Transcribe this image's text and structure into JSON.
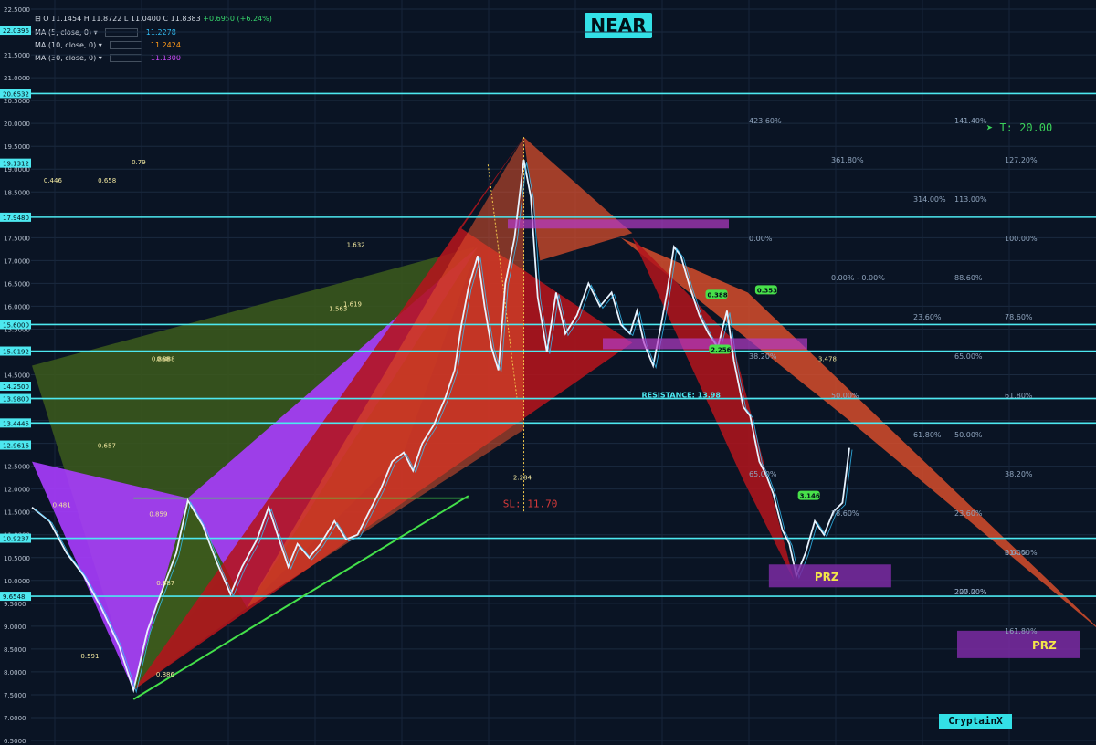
{
  "header": {
    "title": "NEAR",
    "ohlc": "O 11.1454  H 11.8722  L 11.0400  C 11.8383",
    "change": "+0.6950 (+6.24%)",
    "ma": [
      {
        "label": "MA (5, close, 0) ▾",
        "value": "11.2278",
        "color": "#33c6ff"
      },
      {
        "label": "MA (10, close, 0) ▾",
        "value": "11.2424",
        "color": "#ff9a1a"
      },
      {
        "label": "MA (30, close, 0) ▾",
        "value": "11.1300",
        "color": "#d24cff"
      }
    ]
  },
  "watermark": "CryptainX",
  "chart_data": {
    "type": "line",
    "ylim": [
      6.6,
      22.5
    ],
    "y_ticks": [
      "22.5000",
      "22.0000",
      "21.5000",
      "21.0000",
      "20.5000",
      "20.0000",
      "19.5000",
      "19.0000",
      "18.5000",
      "18.0000",
      "17.5000",
      "17.0000",
      "16.5000",
      "16.0000",
      "15.5000",
      "15.0000",
      "14.5000",
      "14.0000",
      "13.5000",
      "13.0000",
      "12.5000",
      "12.0000",
      "11.5000",
      "11.0000",
      "10.5000",
      "10.0000",
      "9.5000",
      "9.0000",
      "8.5000",
      "8.0000",
      "7.5000",
      "7.0000",
      "6.5000"
    ],
    "highlighted_y_labels": [
      {
        "value": 22.0396,
        "text": "22.0396"
      },
      {
        "value": 20.6532,
        "text": "20.6532"
      },
      {
        "value": 19.1312,
        "text": "19.1312"
      },
      {
        "value": 17.948,
        "text": "17.9480"
      },
      {
        "value": 15.6,
        "text": "15.6000"
      },
      {
        "value": 15.0192,
        "text": "15.0192"
      },
      {
        "value": 14.25,
        "text": "14.2500"
      },
      {
        "value": 13.98,
        "text": "13.9800"
      },
      {
        "value": 13.4445,
        "text": "13.4445"
      },
      {
        "value": 12.9616,
        "text": "12.9616"
      },
      {
        "value": 10.9237,
        "text": "10.9237"
      },
      {
        "value": 9.6548,
        "text": "9.6548"
      }
    ],
    "horizontal_levels": [
      20.6532,
      17.948,
      15.6,
      15.0192,
      13.98,
      13.4445,
      10.9237,
      9.6548
    ],
    "price": [
      [
        0,
        11.6
      ],
      [
        15,
        11.3
      ],
      [
        30,
        10.6
      ],
      [
        45,
        10.1
      ],
      [
        60,
        9.4
      ],
      [
        75,
        8.6
      ],
      [
        88,
        7.6
      ],
      [
        100,
        8.9
      ],
      [
        110,
        9.6
      ],
      [
        125,
        10.6
      ],
      [
        135,
        11.75
      ],
      [
        148,
        11.2
      ],
      [
        160,
        10.4
      ],
      [
        172,
        9.7
      ],
      [
        182,
        10.3
      ],
      [
        195,
        10.9
      ],
      [
        205,
        11.6
      ],
      [
        214,
        10.9
      ],
      [
        222,
        10.3
      ],
      [
        230,
        10.8
      ],
      [
        240,
        10.5
      ],
      [
        250,
        10.8
      ],
      [
        262,
        11.3
      ],
      [
        272,
        10.9
      ],
      [
        282,
        11.0
      ],
      [
        292,
        11.5
      ],
      [
        302,
        12.0
      ],
      [
        312,
        12.6
      ],
      [
        322,
        12.8
      ],
      [
        330,
        12.4
      ],
      [
        338,
        13.0
      ],
      [
        348,
        13.4
      ],
      [
        358,
        14.0
      ],
      [
        366,
        14.6
      ],
      [
        372,
        15.6
      ],
      [
        378,
        16.4
      ],
      [
        386,
        17.1
      ],
      [
        392,
        16.0
      ],
      [
        398,
        15.1
      ],
      [
        404,
        14.6
      ],
      [
        410,
        16.5
      ],
      [
        418,
        17.5
      ],
      [
        426,
        19.2
      ],
      [
        432,
        18.4
      ],
      [
        438,
        16.2
      ],
      [
        446,
        15.0
      ],
      [
        454,
        16.3
      ],
      [
        462,
        15.4
      ],
      [
        472,
        15.8
      ],
      [
        482,
        16.5
      ],
      [
        492,
        16.0
      ],
      [
        502,
        16.3
      ],
      [
        510,
        15.6
      ],
      [
        518,
        15.4
      ],
      [
        524,
        15.9
      ],
      [
        530,
        15.2
      ],
      [
        538,
        14.7
      ],
      [
        545,
        15.6
      ],
      [
        550,
        16.3
      ],
      [
        556,
        17.3
      ],
      [
        562,
        17.1
      ],
      [
        570,
        16.4
      ],
      [
        578,
        15.8
      ],
      [
        586,
        15.4
      ],
      [
        594,
        15.1
      ],
      [
        602,
        15.9
      ],
      [
        608,
        14.8
      ],
      [
        616,
        13.8
      ],
      [
        622,
        13.6
      ],
      [
        630,
        12.6
      ],
      [
        636,
        12.3
      ],
      [
        642,
        11.9
      ],
      [
        650,
        11.1
      ],
      [
        656,
        10.8
      ],
      [
        662,
        10.1
      ],
      [
        670,
        10.6
      ],
      [
        678,
        11.3
      ],
      [
        686,
        11.0
      ],
      [
        694,
        11.5
      ],
      [
        702,
        11.7
      ],
      [
        708,
        12.9
      ]
    ],
    "price_x_range": [
      0,
      708
    ],
    "labels": [
      {
        "x": 0.79,
        "y": 19.1,
        "text": "0.79"
      },
      {
        "x": 1.619,
        "y": 16.0,
        "text": "1.619"
      },
      {
        "x": 1.563,
        "y": 15.9,
        "text": "1.563"
      },
      {
        "x": 3.478,
        "y": 14.8,
        "text": "3.478"
      },
      {
        "x": 0.657,
        "y": 12.9,
        "text": "0.657"
      },
      {
        "x": 0.481,
        "y": 11.6,
        "text": "0.481"
      },
      {
        "x": 0.887,
        "y": 9.9,
        "text": "0.887"
      },
      {
        "x": 0.886,
        "y": 7.9,
        "text": "0.886"
      },
      {
        "x": 0.591,
        "y": 8.3,
        "text": "0.591"
      },
      {
        "x": 0.446,
        "y": 18.7,
        "text": "0.446"
      },
      {
        "x": 0.658,
        "y": 18.7,
        "text": "0.658"
      },
      {
        "x": 0.868,
        "y": 14.8,
        "text": "0.868"
      },
      {
        "x": 0.888,
        "y": 14.8,
        "text": "0.888"
      },
      {
        "x": 1.632,
        "y": 17.3,
        "text": "1.632"
      },
      {
        "x": 2.284,
        "y": 12.2,
        "text": "2.284"
      },
      {
        "x": 0.859,
        "y": 11.4,
        "text": "0.859"
      }
    ],
    "fib_labels": [
      "423.60%",
      "361.80%",
      "314.00%",
      "0.00%",
      "0.00% - 0.00%",
      "23.60%",
      "38.20%",
      "50.00%",
      "61.80%",
      "65.00%",
      "78.60%",
      "214.00%",
      "200.00%",
      "161.80%",
      "141.40%",
      "127.20%",
      "113.00%",
      "100.00%",
      "88.60%",
      "78.60%",
      "65.00%",
      "61.80%",
      "50.00%",
      "38.20%",
      "23.60%",
      "0.00%",
      "227.20%"
    ],
    "annotations": {
      "target": "T: 20.00",
      "stop": "SL: 11.70",
      "resistance": "RESISTANCE: 13.98",
      "prz": "PRZ",
      "prz2": "PRZ",
      "green_nums": [
        "0.388",
        "0.353",
        "2.256",
        "3.146"
      ]
    }
  }
}
